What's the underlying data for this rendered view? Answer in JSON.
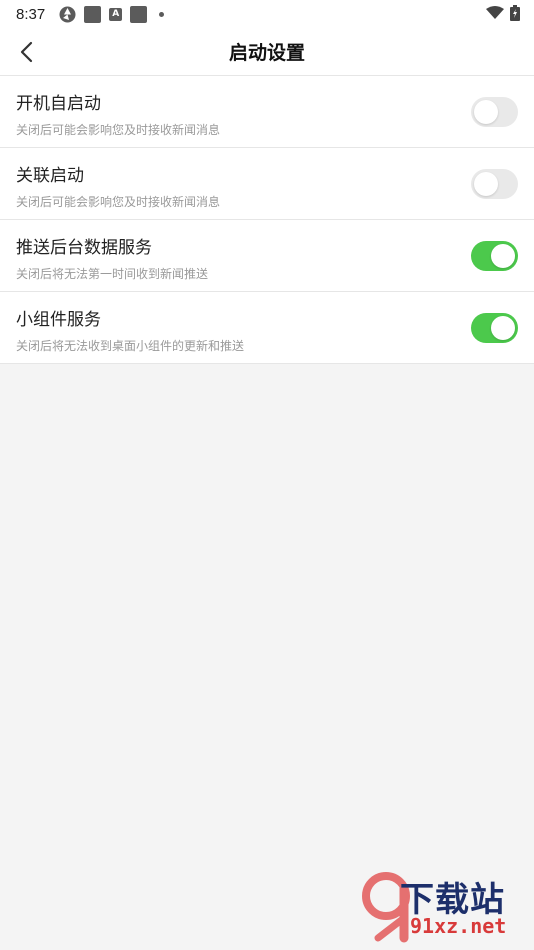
{
  "status_bar": {
    "time": "8:37",
    "accent_color": "#5b5b5b"
  },
  "header": {
    "title": "启动设置",
    "back_icon": "chevron-left-icon"
  },
  "settings": [
    {
      "title": "开机自启动",
      "subtitle": "关闭后可能会影响您及时接收新闻消息",
      "enabled": false
    },
    {
      "title": "关联启动",
      "subtitle": "关闭后可能会影响您及时接收新闻消息",
      "enabled": false
    },
    {
      "title": "推送后台数据服务",
      "subtitle": "关闭后将无法第一时间收到新闻推送",
      "enabled": true
    },
    {
      "title": "小组件服务",
      "subtitle": "关闭后将无法收到桌面小组件的更新和推送",
      "enabled": true
    }
  ],
  "colors": {
    "toggle_on": "#4cc94c",
    "toggle_off": "#e9e9e9"
  },
  "watermark": {
    "brand": "下载站",
    "url": "91xz.net"
  }
}
